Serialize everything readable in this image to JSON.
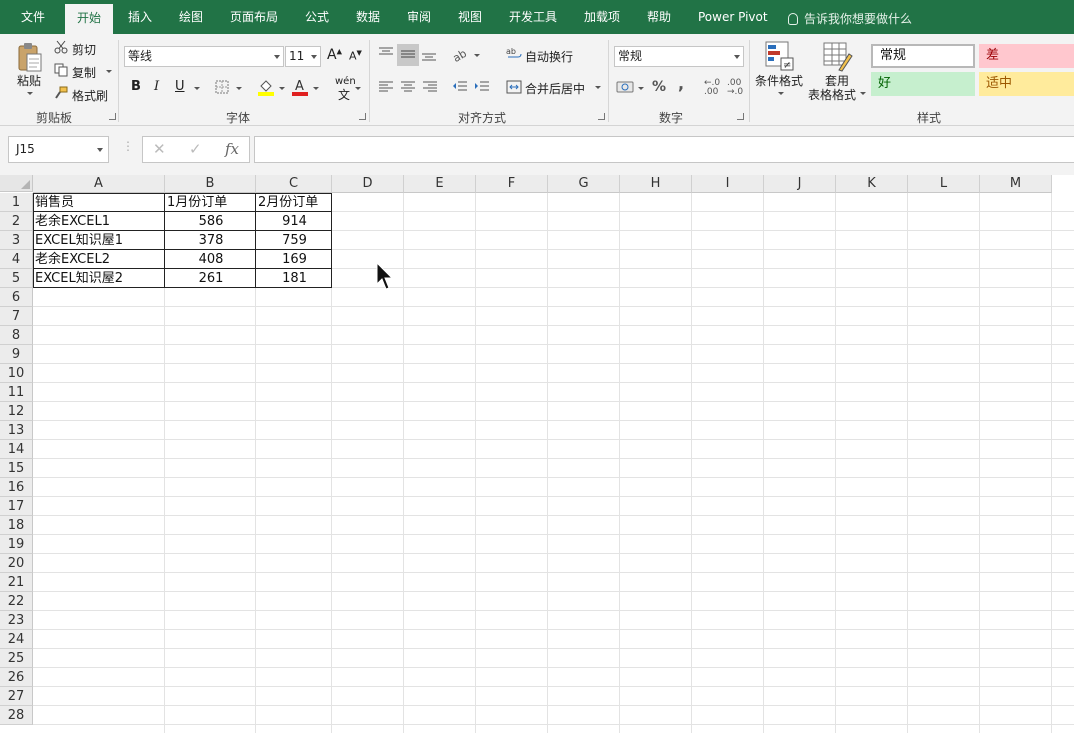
{
  "tabs": [
    {
      "label": "文件",
      "active": false
    },
    {
      "label": "开始",
      "active": true
    },
    {
      "label": "插入",
      "active": false
    },
    {
      "label": "绘图",
      "active": false
    },
    {
      "label": "页面布局",
      "active": false
    },
    {
      "label": "公式",
      "active": false
    },
    {
      "label": "数据",
      "active": false
    },
    {
      "label": "审阅",
      "active": false
    },
    {
      "label": "视图",
      "active": false
    },
    {
      "label": "开发工具",
      "active": false
    },
    {
      "label": "加载项",
      "active": false
    },
    {
      "label": "帮助",
      "active": false
    },
    {
      "label": "Power Pivot",
      "active": false
    }
  ],
  "tell_me": "告诉我你想要做什么",
  "ribbon": {
    "clipboard": {
      "group_label": "剪贴板",
      "paste": "粘贴",
      "cut": "剪切",
      "copy": "复制",
      "format_painter": "格式刷"
    },
    "font": {
      "group_label": "字体",
      "font_name": "等线",
      "font_size": "11",
      "bold": "B",
      "italic": "I",
      "underline": "U",
      "phonetic": "wén",
      "font_color": "#e02020",
      "fill_color": "#ffff00"
    },
    "alignment": {
      "group_label": "对齐方式",
      "wrap_text": "自动换行",
      "merge_center": "合并后居中"
    },
    "number": {
      "group_label": "数字",
      "format": "常规",
      "percent": "%",
      "comma": ","
    },
    "styles": {
      "group_label": "样式",
      "conditional_format": "条件格式",
      "table_format_1": "套用",
      "table_format_2": "表格格式",
      "normal": "常规",
      "bad": "差",
      "good": "好",
      "neutral": "适中"
    }
  },
  "formula_bar": {
    "name_box": "J15",
    "formula": "",
    "fx": "fx"
  },
  "sheet": {
    "columns": [
      "A",
      "B",
      "C",
      "D",
      "E",
      "F",
      "G",
      "H",
      "I",
      "J",
      "K",
      "L",
      "M"
    ],
    "rows": [
      "1",
      "2",
      "3",
      "4",
      "5",
      "6",
      "7",
      "8",
      "9",
      "10",
      "11",
      "12",
      "13",
      "14",
      "15",
      "16",
      "17",
      "18",
      "19",
      "20",
      "21",
      "22",
      "23",
      "24",
      "25",
      "26",
      "27",
      "28"
    ],
    "headers": [
      "销售员",
      "1月份订单",
      "2月份订单"
    ],
    "data": [
      [
        "老余EXCEL1",
        "586",
        "914"
      ],
      [
        "EXCEL知识屋1",
        "378",
        "759"
      ],
      [
        "老余EXCEL2",
        "408",
        "169"
      ],
      [
        "EXCEL知识屋2",
        "261",
        "181"
      ]
    ]
  },
  "colors": {
    "accent": "#217346",
    "bad_bg": "#ffc7ce",
    "bad_fg": "#9c0006",
    "good_bg": "#c6efce",
    "good_fg": "#006100",
    "neutral_bg": "#ffeb9c",
    "neutral_fg": "#9c5700"
  }
}
